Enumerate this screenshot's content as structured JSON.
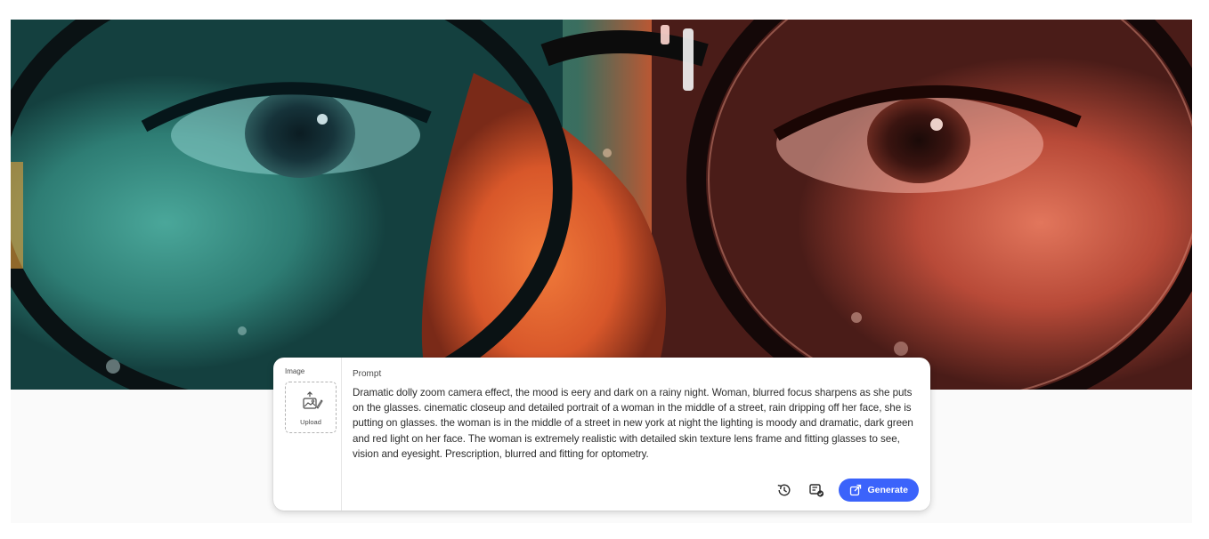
{
  "hero": {
    "image_icon": "hero-image"
  },
  "prompt_panel": {
    "image_label": "Image",
    "upload_label": "Upload",
    "upload_icon": "upload-image-icon",
    "prompt_label": "Prompt",
    "prompt_text": "Dramatic dolly zoom camera effect, the mood is eery and dark on a rainy night. Woman, blurred focus sharpens as she puts on the glasses. cinematic closeup and detailed portrait of a woman in the middle of a street, rain dripping off her face, she is putting on glasses. the woman is in the middle of a street in new york at night the lighting is moody and dramatic, dark green and red light on her face. The woman is extremely realistic with detailed skin texture lens frame and fitting glasses to see, vision and eyesight. Prescription, blurred and fitting for optometry.",
    "toolbar": {
      "history_icon": "history-icon",
      "prompt_settings_icon": "prompt-settings-icon",
      "generate_label": "Generate",
      "generate_icon": "generate-icon",
      "accent_color": "#3b63fb"
    }
  }
}
